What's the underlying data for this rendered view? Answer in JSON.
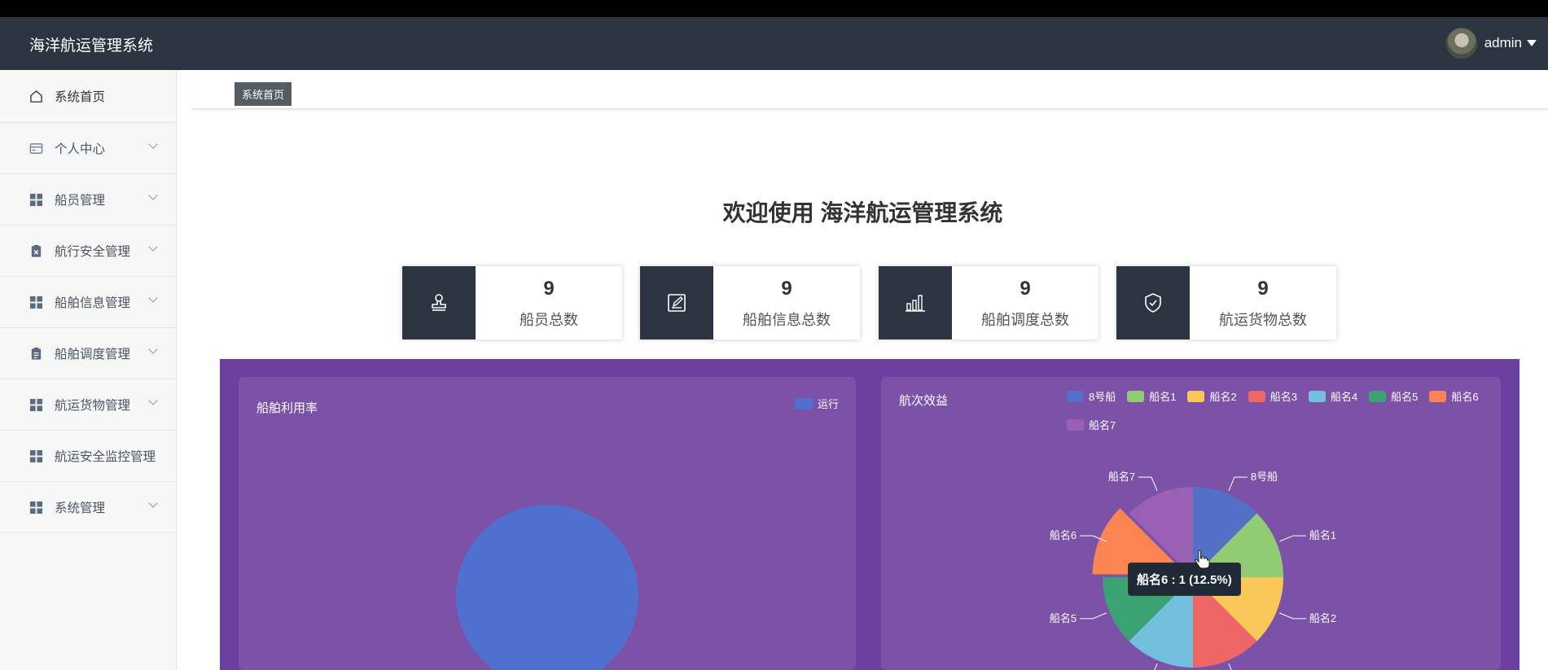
{
  "header": {
    "brand": "海洋航运管理系统",
    "username": "admin"
  },
  "sidebar": {
    "items": [
      {
        "label": "系统首页",
        "icon": "home-icon",
        "chevron": false
      },
      {
        "label": "个人中心",
        "icon": "card-icon",
        "chevron": true
      },
      {
        "label": "船员管理",
        "icon": "grid-icon",
        "chevron": true
      },
      {
        "label": "航行安全管理",
        "icon": "clipboard-x-icon",
        "chevron": true
      },
      {
        "label": "船舶信息管理",
        "icon": "grid-icon",
        "chevron": true
      },
      {
        "label": "船舶调度管理",
        "icon": "clipboard-icon",
        "chevron": true
      },
      {
        "label": "航运货物管理",
        "icon": "grid-icon",
        "chevron": true
      },
      {
        "label": "航运安全监控管理",
        "icon": "grid-icon",
        "chevron": false
      },
      {
        "label": "系统管理",
        "icon": "grid-icon",
        "chevron": true
      }
    ]
  },
  "breadcrumb": {
    "label": "系统首页"
  },
  "welcome": {
    "title": "欢迎使用 海洋航运管理系统"
  },
  "stats": [
    {
      "value": "9",
      "label": "船员总数",
      "icon": "stamp-icon"
    },
    {
      "value": "9",
      "label": "船舶信息总数",
      "icon": "edit-icon"
    },
    {
      "value": "9",
      "label": "船舶调度总数",
      "icon": "bar-chart-icon"
    },
    {
      "value": "9",
      "label": "航运货物总数",
      "icon": "shield-check-icon"
    }
  ],
  "colors": {
    "header": "#2b3440",
    "panel": "#6b3fa0",
    "card": "#7b52a8"
  },
  "chart_data": [
    {
      "type": "pie",
      "title": "船舶利用率",
      "legend": [
        "运行"
      ],
      "legend_position": "top-right",
      "slices": [
        {
          "name": "运行",
          "value": 1,
          "color": "#5070d0"
        }
      ]
    },
    {
      "type": "pie",
      "title": "航次效益",
      "legend": [
        "8号船",
        "船名1",
        "船名2",
        "船名3",
        "船名4",
        "船名5",
        "船名6",
        "船名7"
      ],
      "legend_position": "top",
      "slices": [
        {
          "name": "8号船",
          "value": 1,
          "color": "#5470c6"
        },
        {
          "name": "船名1",
          "value": 1,
          "color": "#91cc75"
        },
        {
          "name": "船名2",
          "value": 1,
          "color": "#fac858"
        },
        {
          "name": "船名3",
          "value": 1,
          "color": "#ee6666"
        },
        {
          "name": "船名4",
          "value": 1,
          "color": "#73c0de"
        },
        {
          "name": "船名5",
          "value": 1,
          "color": "#3ba272"
        },
        {
          "name": "船名6",
          "value": 1,
          "color": "#fc8452"
        },
        {
          "name": "船名7",
          "value": 1,
          "color": "#9a60b4"
        }
      ],
      "highlighted": "船名6",
      "tooltip": "船名6 : 1 (12.5%)"
    }
  ]
}
